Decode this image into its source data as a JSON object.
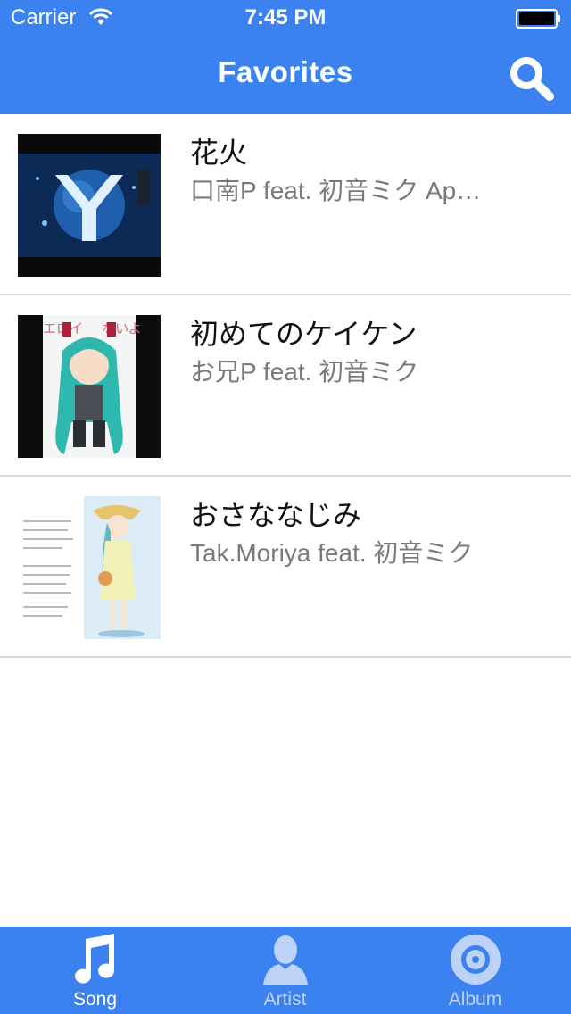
{
  "status": {
    "carrier": "Carrier",
    "time": "7:45 PM"
  },
  "nav": {
    "title": "Favorites"
  },
  "songs": [
    {
      "title": "花火",
      "subtitle": "口南P feat. 初音ミク Ap…"
    },
    {
      "title": "初めてのケイケン",
      "subtitle": "お兄P feat. 初音ミク",
      "art_text_left": "エロイ",
      "art_text_right": "ないよ"
    },
    {
      "title": "おさななじみ",
      "subtitle": "Tak.Moriya feat. 初音ミク"
    }
  ],
  "tabs": [
    {
      "label": "Song",
      "icon": "music-note-icon",
      "selected": true
    },
    {
      "label": "Artist",
      "icon": "person-icon",
      "selected": false
    },
    {
      "label": "Album",
      "icon": "disc-icon",
      "selected": false
    }
  ],
  "colors": {
    "accent": "#3b82f0",
    "tab_selected": "#ffffff",
    "tab_unselected": "#bcd3f7"
  }
}
